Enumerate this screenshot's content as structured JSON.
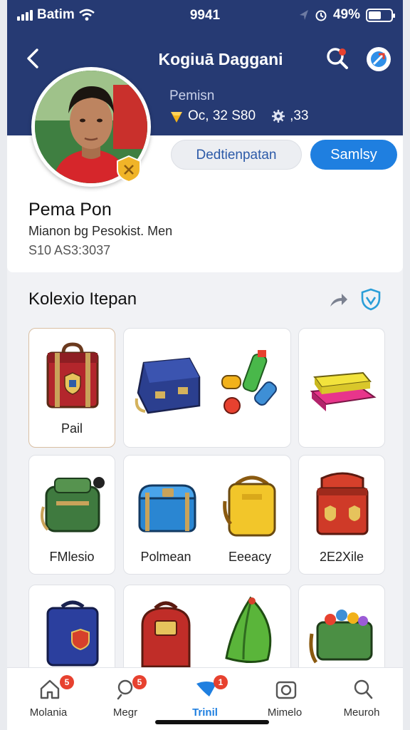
{
  "status_bar": {
    "carrier": "Batim",
    "time": "9941",
    "battery": "49%",
    "battery_level": 0.49
  },
  "header": {
    "title": "Kogiuā Daggani",
    "profile_label": "Pemisn",
    "stats": [
      {
        "icon": "gem-icon",
        "value": "Oc, 32 S80"
      },
      {
        "icon": "gear-icon",
        "value": ",33"
      }
    ]
  },
  "actions": {
    "secondary_label": "Dedtienpatan",
    "primary_label": "Samlsy"
  },
  "profile": {
    "name": "Pema Pon",
    "subtitle": "Mianon bg Pesokist. Men",
    "meta": "S10 AS3:3037"
  },
  "collection": {
    "title": "Kolexio Itepan",
    "items": [
      {
        "label": "Pail",
        "icon": "red-trunk-icon"
      },
      {
        "label": "",
        "icon": "blue-case-icon"
      },
      {
        "label": "",
        "icon": "yellow-pad-icon"
      },
      {
        "label": "FMlesio",
        "icon": "green-backpack-icon"
      },
      {
        "label": "Polmean",
        "icon": "blue-chest-icon"
      },
      {
        "label": "Eeeacy",
        "icon": "yellow-bag-icon"
      },
      {
        "label": "2E2Xile",
        "icon": "red-chest-icon"
      },
      {
        "label": "",
        "icon": "navy-backpack-icon"
      },
      {
        "label": "",
        "icon": "red-backpack-icon"
      },
      {
        "label": "",
        "icon": "green-basket-icon"
      }
    ]
  },
  "tabbar": {
    "tabs": [
      {
        "label": "Molania",
        "badge": "5",
        "active": false
      },
      {
        "label": "Megr",
        "badge": "5",
        "active": false
      },
      {
        "label": "Trinil",
        "badge": "1",
        "active": true
      },
      {
        "label": "Mimelo",
        "badge": "",
        "active": false
      },
      {
        "label": "Meuroh",
        "badge": "",
        "active": false
      }
    ]
  },
  "colors": {
    "header": "#263a73",
    "primary": "#1f7fe0",
    "badge": "#e7412f"
  }
}
